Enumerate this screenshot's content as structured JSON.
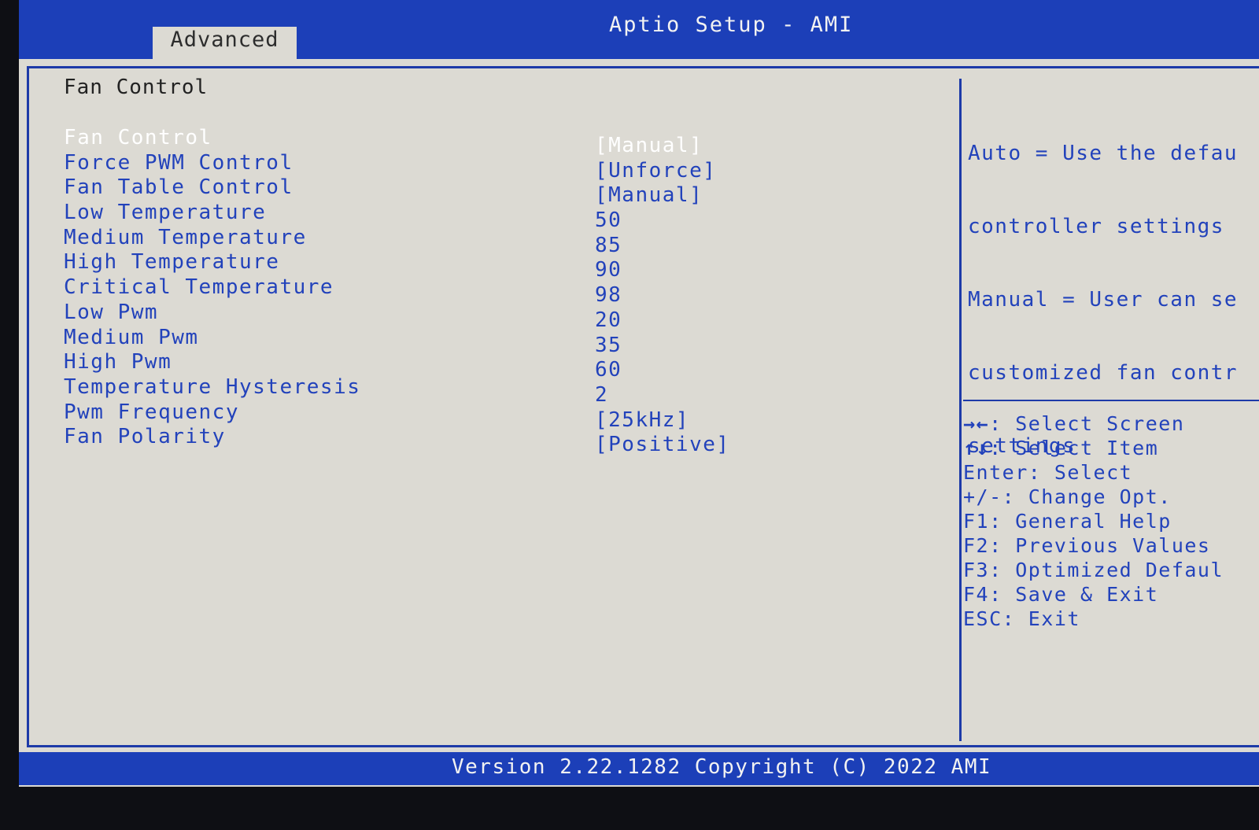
{
  "app": {
    "title": "Aptio Setup - AMI"
  },
  "tabs": [
    {
      "label": "Advanced",
      "active": true
    }
  ],
  "section": {
    "title": "Fan Control"
  },
  "settings": [
    {
      "label": "Fan Control",
      "value": "[Manual]",
      "selected": true
    },
    {
      "label": "Force PWM Control",
      "value": "[Unforce]"
    },
    {
      "label": "Fan Table Control",
      "value": "[Manual]"
    },
    {
      "label": "Low Temperature",
      "value": "50"
    },
    {
      "label": "Medium Temperature",
      "value": "85"
    },
    {
      "label": "High Temperature",
      "value": "90"
    },
    {
      "label": "Critical Temperature",
      "value": "98"
    },
    {
      "label": "Low Pwm",
      "value": "20"
    },
    {
      "label": "Medium Pwm",
      "value": "35"
    },
    {
      "label": "High Pwm",
      "value": "60"
    },
    {
      "label": "Temperature Hysteresis",
      "value": "2"
    },
    {
      "label": "Pwm Frequency",
      "value": "[25kHz]"
    },
    {
      "label": "Fan Polarity",
      "value": "[Positive]"
    }
  ],
  "help": {
    "lines": [
      "Auto = Use the defau",
      "controller settings",
      "Manual = User can se",
      "customized fan contr",
      "settings"
    ]
  },
  "key_help": [
    {
      "key": "→←",
      "action": ": Select Screen"
    },
    {
      "key": "↑↓",
      "action": ": Select Item"
    },
    {
      "key": "Enter",
      "action": ": Select"
    },
    {
      "key": "+/-",
      "action": ": Change Opt."
    },
    {
      "key": "F1",
      "action": ": General Help"
    },
    {
      "key": "F2",
      "action": ": Previous Values"
    },
    {
      "key": "F3",
      "action": ": Optimized Defaul"
    },
    {
      "key": "F4",
      "action": ": Save & Exit"
    },
    {
      "key": "ESC",
      "action": ": Exit"
    }
  ],
  "footer": {
    "text": "Version 2.22.1282 Copyright (C) 2022 AMI"
  },
  "colors": {
    "bar_blue": "#1c3fb8",
    "panel_bg": "#dcdad3",
    "item_blue": "#2242bb",
    "selected_white": "#ffffff"
  }
}
